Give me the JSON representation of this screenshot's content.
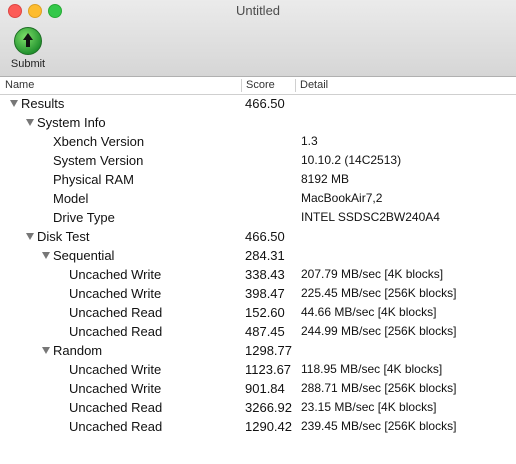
{
  "window": {
    "title": "Untitled"
  },
  "toolbar": {
    "submit_label": "Submit"
  },
  "columns": {
    "name": "Name",
    "score": "Score",
    "detail": "Detail"
  },
  "rows": [
    {
      "name": "Results",
      "score": "466.50",
      "detail": "",
      "level": 0,
      "disclosure": true
    },
    {
      "name": "System Info",
      "score": "",
      "detail": "",
      "level": 1,
      "disclosure": true
    },
    {
      "name": "Xbench Version",
      "score": "",
      "detail": "1.3",
      "level": 2,
      "disclosure": false
    },
    {
      "name": "System Version",
      "score": "",
      "detail": "10.10.2 (14C2513)",
      "level": 2,
      "disclosure": false
    },
    {
      "name": "Physical RAM",
      "score": "",
      "detail": "8192 MB",
      "level": 2,
      "disclosure": false
    },
    {
      "name": "Model",
      "score": "",
      "detail": "MacBookAir7,2",
      "level": 2,
      "disclosure": false
    },
    {
      "name": "Drive Type",
      "score": "",
      "detail": "INTEL SSDSC2BW240A4",
      "level": 2,
      "disclosure": false
    },
    {
      "name": "Disk Test",
      "score": "466.50",
      "detail": "",
      "level": 1,
      "disclosure": true
    },
    {
      "name": "Sequential",
      "score": "284.31",
      "detail": "",
      "level": 2,
      "disclosure": true
    },
    {
      "name": "Uncached Write",
      "score": "338.43",
      "detail": "207.79 MB/sec [4K blocks]",
      "level": 3,
      "disclosure": false
    },
    {
      "name": "Uncached Write",
      "score": "398.47",
      "detail": "225.45 MB/sec [256K blocks]",
      "level": 3,
      "disclosure": false
    },
    {
      "name": "Uncached Read",
      "score": "152.60",
      "detail": "44.66 MB/sec [4K blocks]",
      "level": 3,
      "disclosure": false
    },
    {
      "name": "Uncached Read",
      "score": "487.45",
      "detail": "244.99 MB/sec [256K blocks]",
      "level": 3,
      "disclosure": false
    },
    {
      "name": "Random",
      "score": "1298.77",
      "detail": "",
      "level": 2,
      "disclosure": true
    },
    {
      "name": "Uncached Write",
      "score": "1123.67",
      "detail": "118.95 MB/sec [4K blocks]",
      "level": 3,
      "disclosure": false
    },
    {
      "name": "Uncached Write",
      "score": "901.84",
      "detail": "288.71 MB/sec [256K blocks]",
      "level": 3,
      "disclosure": false
    },
    {
      "name": "Uncached Read",
      "score": "3266.92",
      "detail": "23.15 MB/sec [4K blocks]",
      "level": 3,
      "disclosure": false
    },
    {
      "name": "Uncached Read",
      "score": "1290.42",
      "detail": "239.45 MB/sec [256K blocks]",
      "level": 3,
      "disclosure": false
    }
  ]
}
